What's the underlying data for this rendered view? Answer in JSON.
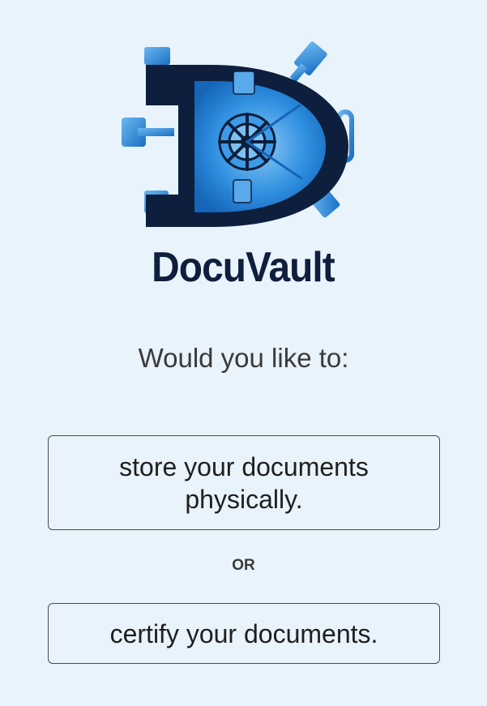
{
  "brand": {
    "name": "DocuVault",
    "logo_icon": "vault-door-icon",
    "colors": {
      "dark": "#0d1f3c",
      "vault_blue": "#2f8fe0"
    }
  },
  "prompt": {
    "question": "Would you like to:"
  },
  "choices": {
    "physical_label": "store your documents physically.",
    "separator": "OR",
    "certify_label": "certify your documents."
  }
}
